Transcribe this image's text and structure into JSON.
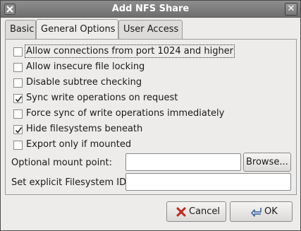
{
  "window": {
    "title": "Add NFS Share"
  },
  "tabs": [
    {
      "label": "Basic"
    },
    {
      "label": "General Options",
      "active": true
    },
    {
      "label": "User Access"
    }
  ],
  "options": [
    {
      "label": "Allow connections from port 1024 and higher",
      "checked": false
    },
    {
      "label": "Allow insecure file locking",
      "checked": false
    },
    {
      "label": "Disable subtree checking",
      "checked": false
    },
    {
      "label": "Sync write operations on request",
      "checked": true
    },
    {
      "label": "Force sync of write operations immediately",
      "checked": false
    },
    {
      "label": "Hide filesystems beneath",
      "checked": true
    },
    {
      "label": "Export only if mounted",
      "checked": false
    }
  ],
  "mount_point": {
    "label": "Optional mount point:",
    "value": "",
    "browse_label": "Browse..."
  },
  "fsid": {
    "label": "Set explicit Filesystem ID:",
    "value": ""
  },
  "buttons": {
    "cancel": "Cancel",
    "ok": "OK"
  },
  "colors": {
    "titlebar": "#7e7e7e",
    "dialog_bg": "#edeceb",
    "cancel_icon": "#c0281c",
    "ok_icon": "#3a5f9a"
  }
}
